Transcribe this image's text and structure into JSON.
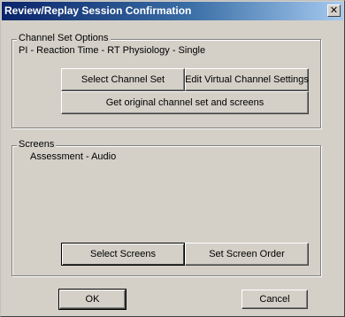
{
  "window": {
    "title": "Review/Replay Session Confirmation",
    "close_glyph": "✕"
  },
  "channel_set": {
    "legend": "Channel Set Options",
    "value": "PI - Reaction Time - RT Physiology - Single",
    "select_label": "Select Channel Set",
    "edit_label": "Edit Virtual Channel Settings",
    "get_original_label": "Get original channel set and screens"
  },
  "screens": {
    "legend": "Screens",
    "value": "Assessment - Audio",
    "select_label": "Select Screens",
    "order_label": "Set Screen Order"
  },
  "footer": {
    "ok_label": "OK",
    "cancel_label": "Cancel"
  },
  "colors": {
    "titlebar_start": "#0a246a",
    "titlebar_end": "#a6caf0",
    "face": "#d4d0c8"
  }
}
